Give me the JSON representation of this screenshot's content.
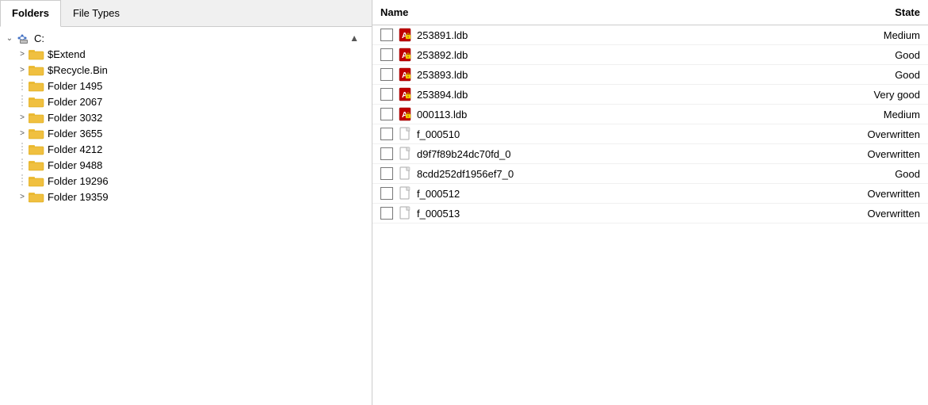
{
  "tabs": [
    {
      "id": "folders",
      "label": "Folders",
      "active": true
    },
    {
      "id": "file-types",
      "label": "File Types",
      "active": false
    }
  ],
  "tree": {
    "root": {
      "label": "C:",
      "expanded": true,
      "icon": "computer",
      "children": [
        {
          "label": "$Extend",
          "expanded": false,
          "hasChildren": true,
          "indent": 1
        },
        {
          "label": "$Recycle.Bin",
          "expanded": false,
          "hasChildren": true,
          "indent": 1
        },
        {
          "label": "Folder 1495",
          "expanded": false,
          "hasChildren": false,
          "indent": 1
        },
        {
          "label": "Folder 2067",
          "expanded": false,
          "hasChildren": false,
          "indent": 1
        },
        {
          "label": "Folder 3032",
          "expanded": false,
          "hasChildren": true,
          "indent": 1
        },
        {
          "label": "Folder 3655",
          "expanded": false,
          "hasChildren": true,
          "indent": 1
        },
        {
          "label": "Folder 4212",
          "expanded": false,
          "hasChildren": false,
          "indent": 1
        },
        {
          "label": "Folder 9488",
          "expanded": false,
          "hasChildren": false,
          "indent": 1
        },
        {
          "label": "Folder 19296",
          "expanded": false,
          "hasChildren": false,
          "indent": 1
        },
        {
          "label": "Folder 19359",
          "expanded": false,
          "hasChildren": true,
          "indent": 1
        }
      ]
    }
  },
  "file_list": {
    "header": {
      "name_col": "Name",
      "state_col": "State"
    },
    "files": [
      {
        "name": "253891.ldb",
        "state": "Medium",
        "type": "access"
      },
      {
        "name": "253892.ldb",
        "state": "Good",
        "type": "access"
      },
      {
        "name": "253893.ldb",
        "state": "Good",
        "type": "access"
      },
      {
        "name": "253894.ldb",
        "state": "Very good",
        "type": "access"
      },
      {
        "name": "000113.ldb",
        "state": "Medium",
        "type": "access"
      },
      {
        "name": "f_000510",
        "state": "Overwritten",
        "type": "file"
      },
      {
        "name": "d9f7f89b24dc70fd_0",
        "state": "Overwritten",
        "type": "file"
      },
      {
        "name": "8cdd252df1956ef7_0",
        "state": "Good",
        "type": "file"
      },
      {
        "name": "f_000512",
        "state": "Overwritten",
        "type": "file"
      },
      {
        "name": "f_000513",
        "state": "Overwritten",
        "type": "file"
      }
    ]
  }
}
